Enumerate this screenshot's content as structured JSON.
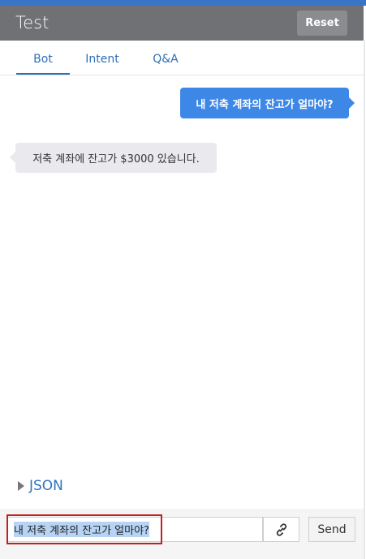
{
  "header": {
    "title": "Test",
    "reset_label": "Reset"
  },
  "tabs": [
    {
      "label": "Bot",
      "active": true
    },
    {
      "label": "Intent",
      "active": false
    },
    {
      "label": "Q&A",
      "active": false
    }
  ],
  "messages": [
    {
      "from": "user",
      "text": "내 저축 계좌의 잔고가 얼마야?"
    },
    {
      "from": "bot",
      "text": "저축 계좌에 잔고가 $3000 있습니다."
    }
  ],
  "json_toggle": {
    "label": "JSON"
  },
  "composer": {
    "input_value": "내 저축 계좌의 잔고가 얼마야?",
    "send_label": "Send",
    "link_icon": "link-icon"
  },
  "colors": {
    "accent": "#3a74c7",
    "header_bg": "#6f7175",
    "user_bubble": "#3d87e7",
    "bot_bubble": "#e9e9ee",
    "link_text": "#2f6fb7",
    "highlight": "#c21f1f"
  }
}
